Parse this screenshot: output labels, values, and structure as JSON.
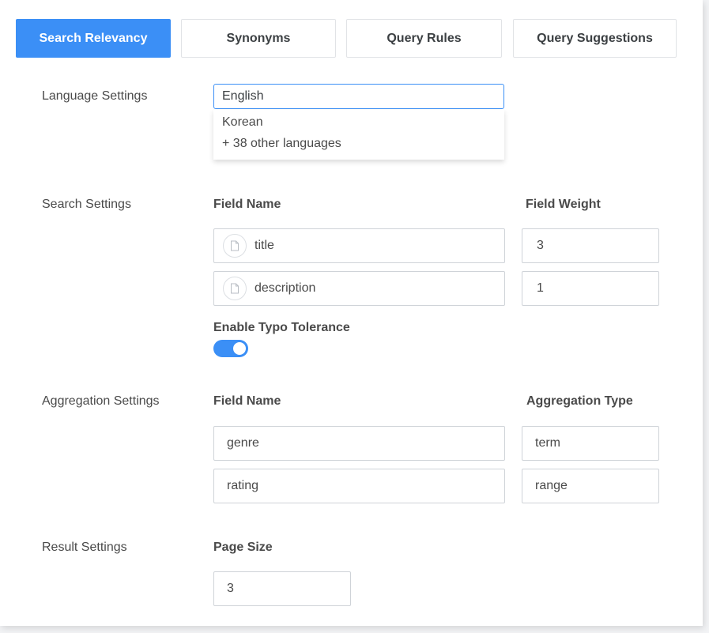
{
  "tabs": [
    {
      "label": "Search Relevancy",
      "active": true
    },
    {
      "label": "Synonyms",
      "active": false
    },
    {
      "label": "Query Rules",
      "active": false
    },
    {
      "label": "Query Suggestions",
      "active": false
    }
  ],
  "language": {
    "label": "Language Settings",
    "selected": "English",
    "options": [
      "Korean",
      "+ 38 other languages"
    ]
  },
  "search": {
    "label": "Search Settings",
    "field_name_header": "Field Name",
    "field_weight_header": "Field Weight",
    "fields": [
      {
        "name": "title",
        "weight": "3",
        "icon": "document-icon"
      },
      {
        "name": "description",
        "weight": "1",
        "icon": "document-icon"
      }
    ],
    "typo_tolerance_label": "Enable Typo Tolerance",
    "typo_tolerance_enabled": true
  },
  "aggregation": {
    "label": "Aggregation Settings",
    "field_name_header": "Field Name",
    "type_header": "Aggregation Type",
    "fields": [
      {
        "name": "genre",
        "type": "term"
      },
      {
        "name": "rating",
        "type": "range"
      }
    ]
  },
  "result": {
    "label": "Result Settings",
    "page_size_header": "Page Size",
    "page_size": "3"
  },
  "colors": {
    "accent": "#3b8ff6",
    "border": "#cfd3d8",
    "text": "#4a4a4a"
  }
}
